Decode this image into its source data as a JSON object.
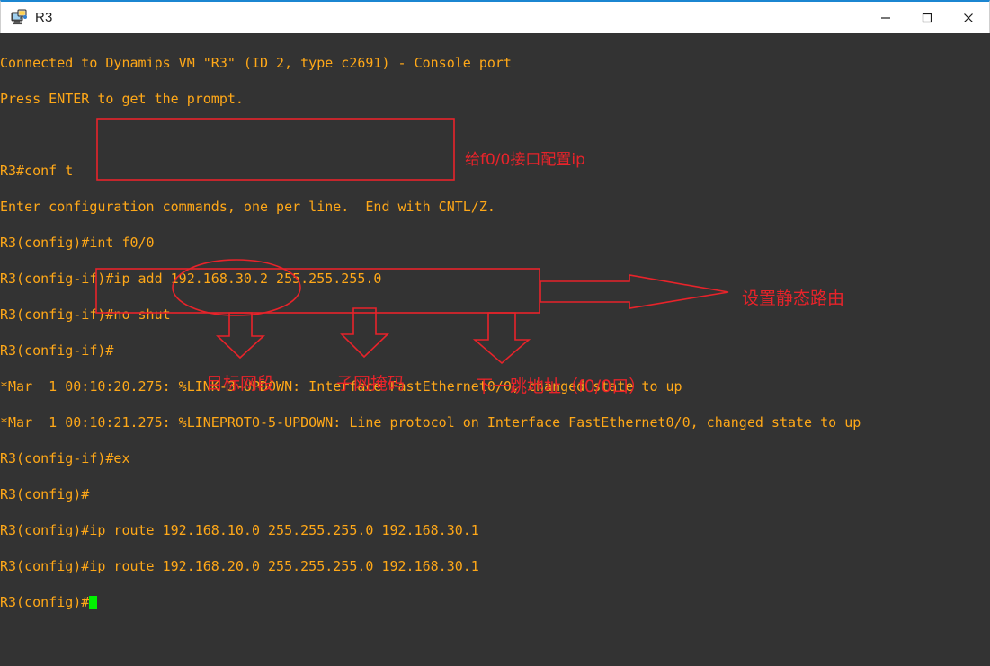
{
  "window": {
    "title": "R3",
    "icon": "computer-console-icon",
    "controls": {
      "minimize": "—",
      "maximize": "□",
      "close": "✕"
    },
    "accent_color": "#1b86d1"
  },
  "terminal": {
    "background_color": "#333333",
    "text_color": "#ffa818",
    "cursor_color": "#00f200",
    "lines": [
      "Connected to Dynamips VM \"R3\" (ID 2, type c2691) - Console port",
      "Press ENTER to get the prompt.",
      "",
      "R3#conf t",
      "Enter configuration commands, one per line.  End with CNTL/Z.",
      "R3(config)#int f0/0",
      "R3(config-if)#ip add 192.168.30.2 255.255.255.0",
      "R3(config-if)#no shut",
      "R3(config-if)#",
      "*Mar  1 00:10:20.275: %LINK-3-UPDOWN: Interface FastEthernet0/0, changed state to up",
      "*Mar  1 00:10:21.275: %LINEPROTO-5-UPDOWN: Line protocol on Interface FastEthernet0/0, changed state to up",
      "R3(config-if)#ex",
      "R3(config)#",
      "R3(config)#ip route 192.168.10.0 255.255.255.0 192.168.30.1",
      "R3(config)#ip route 192.168.20.0 255.255.255.0 192.168.30.1",
      "R3(config)#"
    ]
  },
  "annotations": {
    "color": "#e8232a",
    "interface_config_label": "给f0/0接口配置ip",
    "static_route_label": "设置静态路由",
    "target_network_label": "目标网段",
    "subnet_mask_label": "子网掩码",
    "next_hop_label": "下一跳地址（f0/0口）"
  }
}
